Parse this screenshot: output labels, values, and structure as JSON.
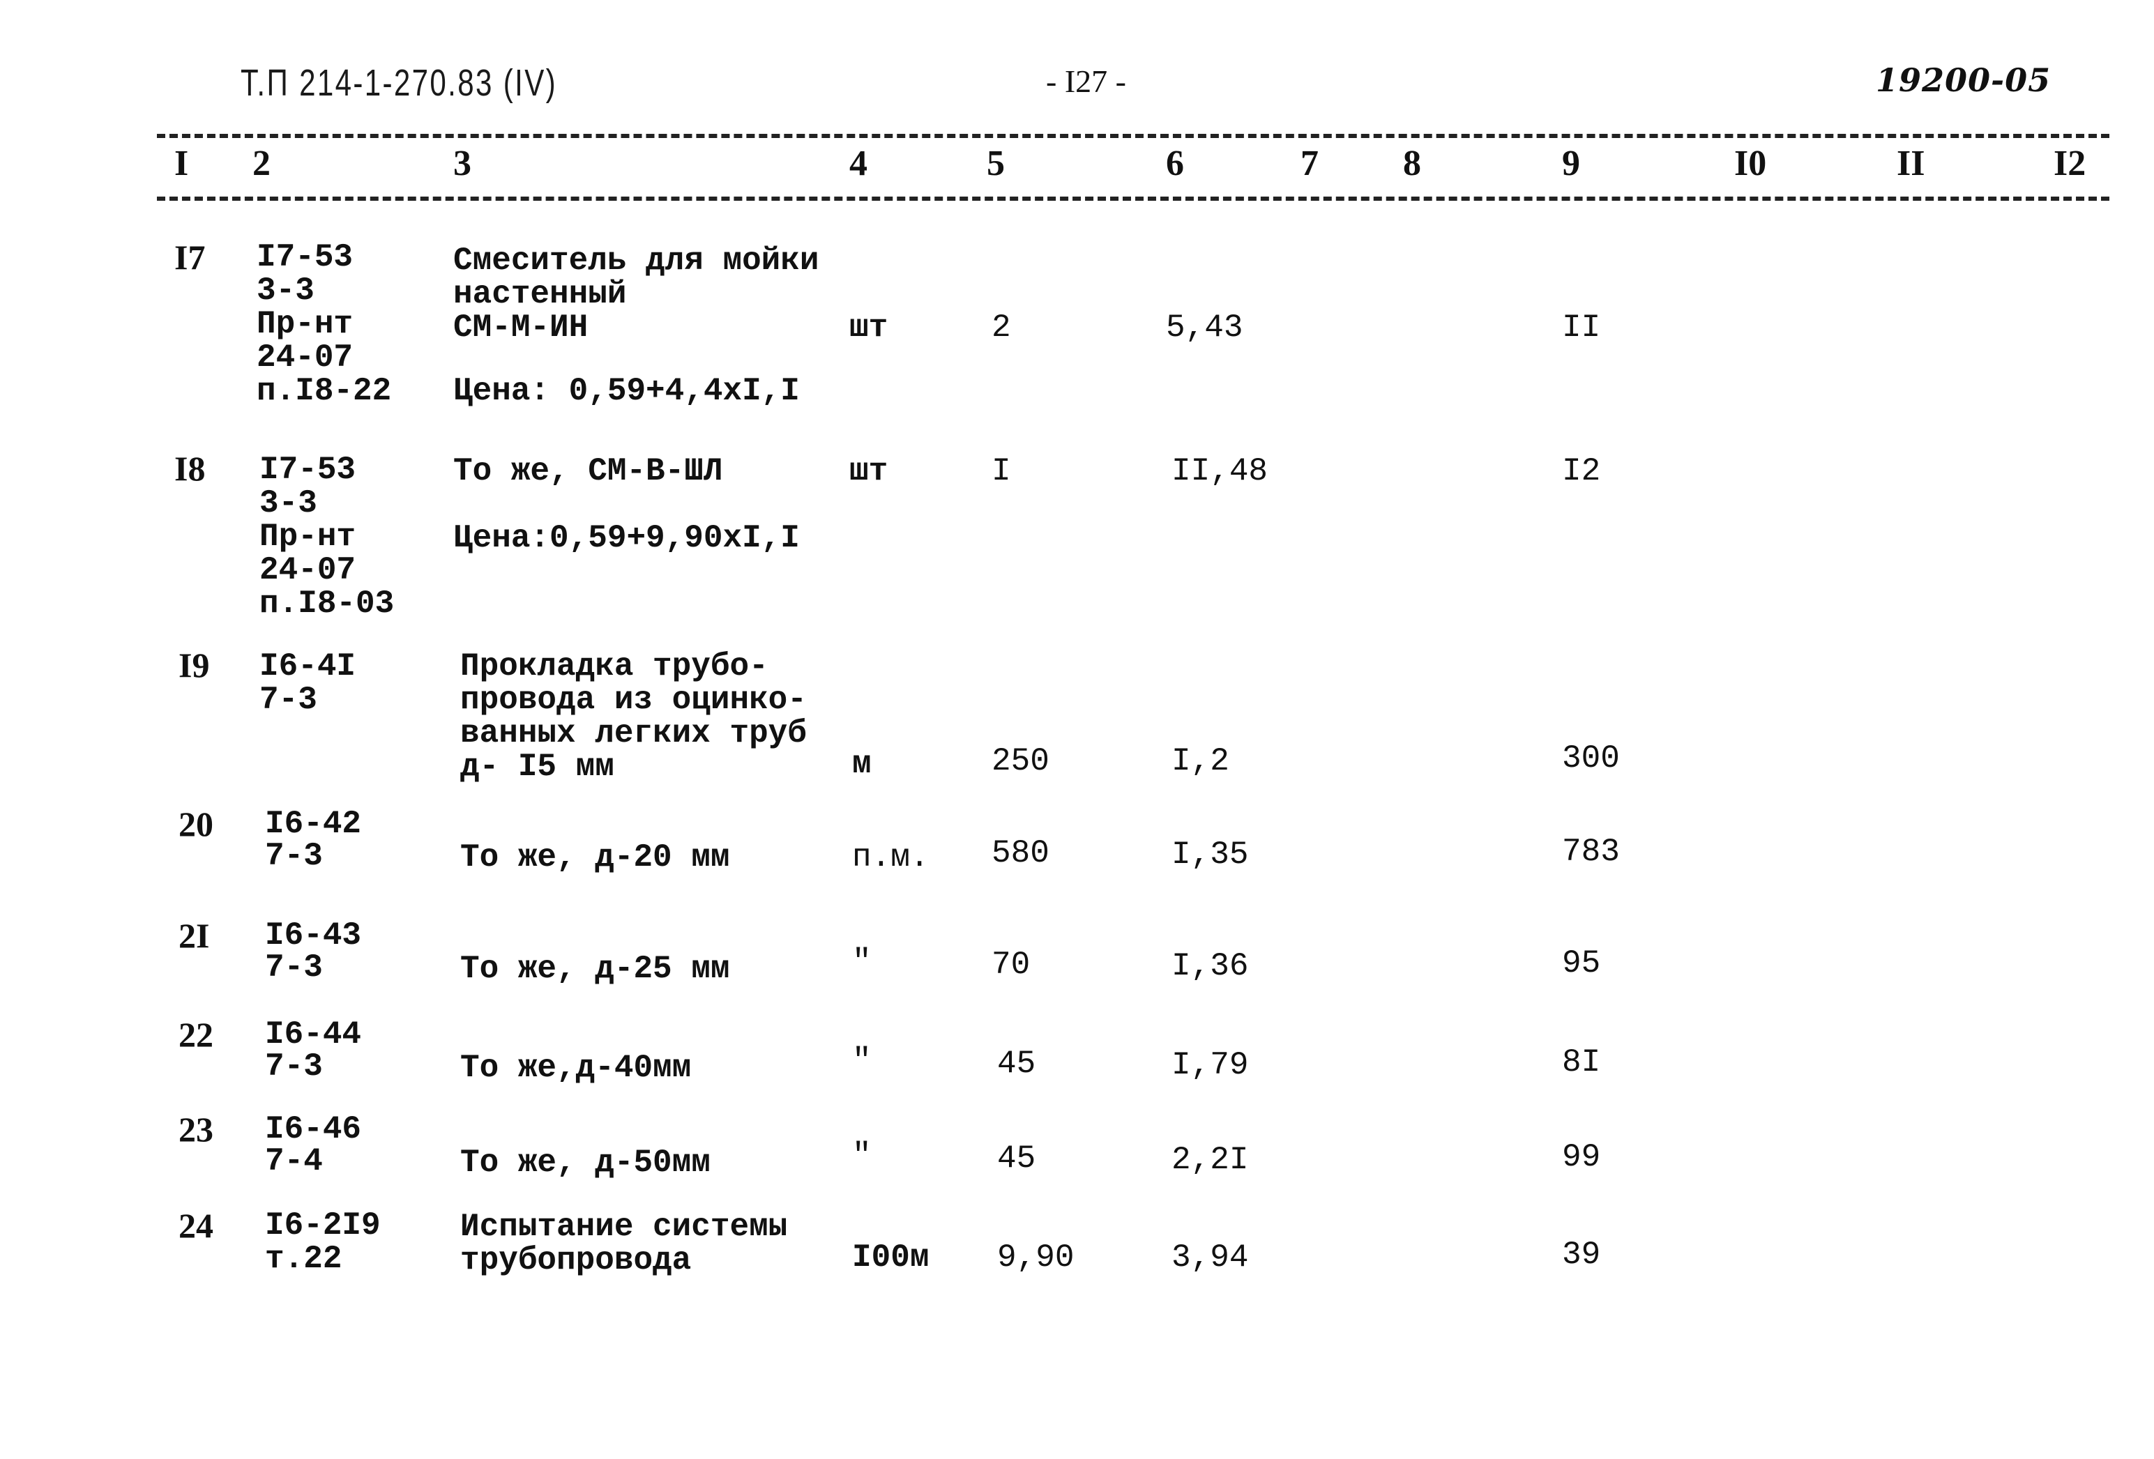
{
  "header": {
    "doc_code": "Т.П 214-1-270.83 (IV)",
    "page_number": "- I27 -",
    "sheet_code": "19200-05"
  },
  "columns": [
    "I",
    "2",
    "3",
    "4",
    "5",
    "6",
    "7",
    "8",
    "9",
    "I0",
    "II",
    "I2"
  ],
  "rows": [
    {
      "no": "I7",
      "code": [
        "I7-53",
        "3-3",
        "Пр-нт",
        "24-07",
        "п.I8-22"
      ],
      "description": [
        "Смеситель для мойки",
        "настенный",
        "СМ-М-ИН",
        "",
        "Цена: 0,59+4,4xI,I"
      ],
      "unit": "шт",
      "qty": "2",
      "price": "5,43",
      "total": "II"
    },
    {
      "no": "I8",
      "code": [
        "I7-53",
        "3-3",
        "Пр-нт",
        "24-07",
        "п.I8-03"
      ],
      "description": [
        "То же, СМ-В-ШЛ",
        "",
        "Цена:0,59+9,90xI,I"
      ],
      "unit": "шт",
      "qty": "I",
      "price": "II,48",
      "total": "I2"
    },
    {
      "no": "I9",
      "code": [
        "I6-4I",
        "7-3"
      ],
      "description": [
        "Прокладка трубо-",
        "провода из оцинко-",
        "ванных легких труб",
        "д- I5 мм"
      ],
      "unit": "м",
      "qty": "250",
      "price": "I,2",
      "total": "300"
    },
    {
      "no": "20",
      "code": [
        "I6-42",
        "7-3"
      ],
      "description": [
        "То же, д-20 мм"
      ],
      "unit": "п.м.",
      "qty": "580",
      "price": "I,35",
      "total": "783"
    },
    {
      "no": "2I",
      "code": [
        "I6-43",
        "7-3"
      ],
      "description": [
        "То же, д-25 мм"
      ],
      "unit": "\"",
      "qty": "70",
      "price": "I,36",
      "total": "95"
    },
    {
      "no": "22",
      "code": [
        "I6-44",
        "7-3"
      ],
      "description": [
        "То же,д-40мм"
      ],
      "unit": "\"",
      "qty": "45",
      "price": "I,79",
      "total": "8I"
    },
    {
      "no": "23",
      "code": [
        "I6-46",
        "7-4"
      ],
      "description": [
        "То же, д-50мм"
      ],
      "unit": "\"",
      "qty": "45",
      "price": "2,2I",
      "total": "99"
    },
    {
      "no": "24",
      "code": [
        "I6-2I9",
        "т.22"
      ],
      "description": [
        "Испытание системы",
        "трубопровода"
      ],
      "unit": "I00м",
      "qty": "9,90",
      "price": "3,94",
      "total": "39"
    }
  ]
}
